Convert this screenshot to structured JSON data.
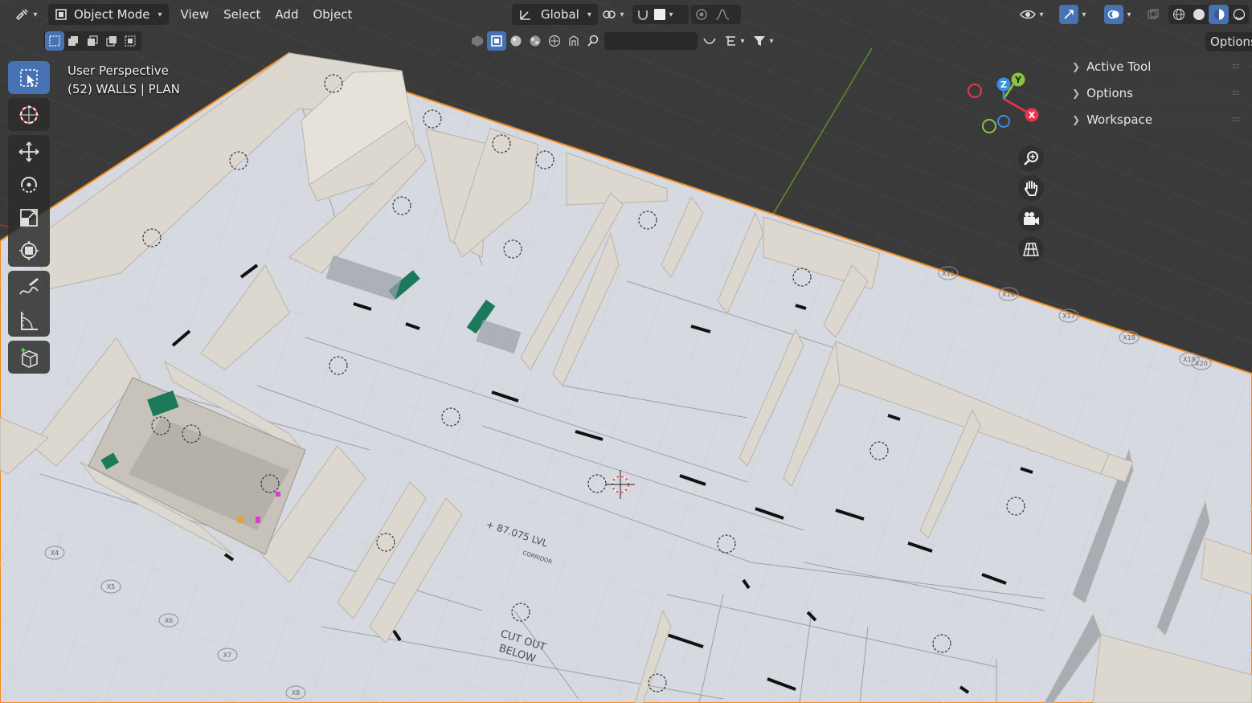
{
  "header": {
    "editor_type_icon": "editor-type-icon",
    "mode_label": "Object Mode",
    "menus": [
      "View",
      "Select",
      "Add",
      "Object"
    ],
    "transform_orientation": "Global",
    "options_label": "Options"
  },
  "viewport": {
    "view_name": "User Perspective",
    "collection_info": "(52) WALLS | PLAN"
  },
  "sidebar": {
    "panels": [
      "Active Tool",
      "Options",
      "Workspace"
    ]
  },
  "gizmo": {
    "axes": [
      "X",
      "Y",
      "Z"
    ],
    "colors": {
      "x": "#e8354e",
      "y": "#8ac43b",
      "z": "#3b8fe0"
    }
  },
  "tools": [
    "select-box-icon",
    "cursor-icon",
    "move-icon",
    "rotate-icon",
    "scale-icon",
    "transform-icon",
    "annotate-icon",
    "measure-icon",
    "add-cube-icon"
  ],
  "plan_labels": {
    "level": "+ 87.075 LVL",
    "cutout": "CUT OUT",
    "cutout2": "BELOW",
    "corridor": "CORRIDOR",
    "grid": [
      "X4",
      "X5",
      "X6",
      "X7",
      "X8",
      "X15",
      "X16",
      "X17",
      "X18",
      "X19",
      "X20"
    ]
  },
  "colors": {
    "accent": "#4772b3",
    "selection_outline": "#f28a1c",
    "viewport_bg": "#3d3d3d",
    "plan_bg": "#d6d9df",
    "wall": "#ddd8cf",
    "door_green": "#1a7a5a"
  }
}
